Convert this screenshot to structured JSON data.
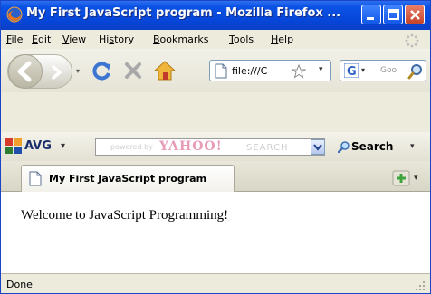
{
  "window": {
    "title": "My First JavaScript program - Mozilla Firefox ..."
  },
  "menu": {
    "file": {
      "underline": "F",
      "rest": "ile"
    },
    "edit": {
      "underline": "E",
      "rest": "dit"
    },
    "view": {
      "underline": "V",
      "rest": "iew"
    },
    "history": {
      "before": "Hi",
      "underline": "s",
      "rest": "tory"
    },
    "bookmarks": {
      "underline": "B",
      "rest": "ookmarks"
    },
    "tools": {
      "underline": "T",
      "rest": "ools"
    },
    "help": {
      "underline": "H",
      "rest": "elp"
    }
  },
  "navigation": {
    "url": "file:///C",
    "search_placeholder": "Goo"
  },
  "avg_toolbar": {
    "brand": "AVG",
    "powered_by": "powered by",
    "yahoo": "YAHOO!",
    "search_word": "SEARCH",
    "search_button": "Search"
  },
  "tabs": [
    {
      "label": "My First JavaScript program"
    }
  ],
  "content": {
    "text": "Welcome to JavaScript Programming!"
  },
  "status": {
    "text": "Done"
  },
  "colors": {
    "titlebar": "#0645d7",
    "avg_blue": "#1a2d6b",
    "yahoo_pink": "#e79bb7"
  }
}
